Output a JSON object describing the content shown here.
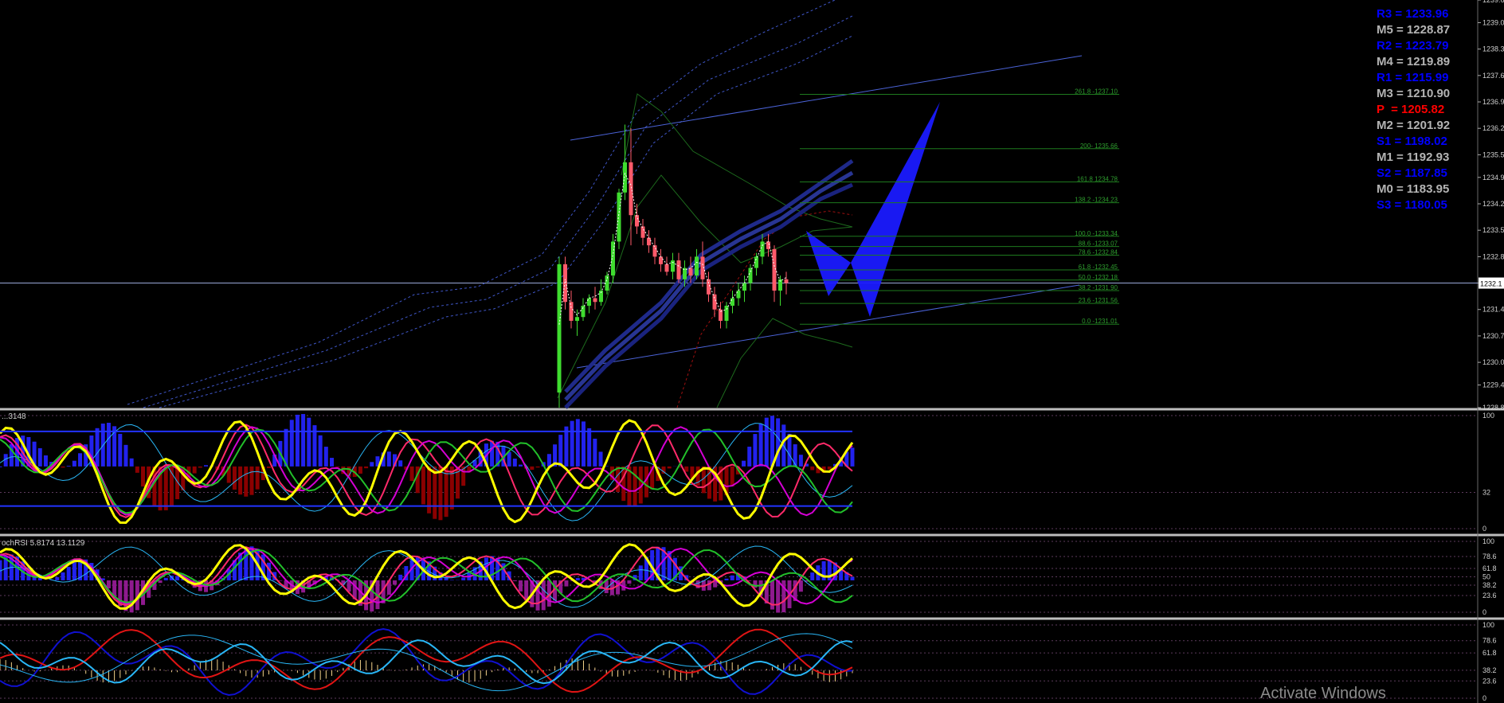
{
  "chart_data": {
    "type": "line",
    "main": {
      "ylim": [
        1228.8,
        1239.6
      ],
      "price_ticks": [
        1239.6,
        1239.0,
        1238.3,
        1237.6,
        1236.9,
        1236.2,
        1235.5,
        1234.9,
        1234.2,
        1233.5,
        1232.8,
        1232.1,
        1231.4,
        1230.7,
        1230.0,
        1229.4,
        1228.8
      ],
      "current_price_label": "1232.1",
      "current_price": 1232.1,
      "candles": [
        [
          1229.2,
          1232.8,
          1228.8,
          1232.6
        ],
        [
          1232.6,
          1232.8,
          1231.4,
          1231.6
        ],
        [
          1231.6,
          1231.9,
          1230.9,
          1231.1
        ],
        [
          1231.1,
          1231.4,
          1230.7,
          1231.2
        ],
        [
          1231.2,
          1231.7,
          1231.1,
          1231.5
        ],
        [
          1231.5,
          1231.8,
          1231.3,
          1231.7
        ],
        [
          1231.7,
          1232.0,
          1231.4,
          1231.6
        ],
        [
          1231.6,
          1232.2,
          1231.5,
          1231.9
        ],
        [
          1231.9,
          1232.4,
          1231.8,
          1232.3
        ],
        [
          1232.3,
          1233.4,
          1232.1,
          1233.2
        ],
        [
          1233.2,
          1234.6,
          1233.0,
          1234.5
        ],
        [
          1234.5,
          1236.3,
          1234.3,
          1235.3
        ],
        [
          1235.3,
          1236.2,
          1233.1,
          1233.9
        ],
        [
          1233.9,
          1234.2,
          1233.4,
          1233.6
        ],
        [
          1233.6,
          1233.8,
          1233.1,
          1233.3
        ],
        [
          1233.3,
          1233.5,
          1232.9,
          1233.1
        ],
        [
          1233.1,
          1233.3,
          1232.6,
          1232.8
        ],
        [
          1232.8,
          1233.0,
          1232.4,
          1232.6
        ],
        [
          1232.6,
          1232.8,
          1232.3,
          1232.4
        ],
        [
          1232.4,
          1232.9,
          1232.2,
          1232.7
        ],
        [
          1232.7,
          1232.9,
          1232.1,
          1232.2
        ],
        [
          1232.2,
          1232.7,
          1232.0,
          1232.5
        ],
        [
          1232.5,
          1232.8,
          1232.1,
          1232.3
        ],
        [
          1232.3,
          1233.0,
          1232.2,
          1232.8
        ],
        [
          1232.8,
          1233.2,
          1232.0,
          1232.2
        ],
        [
          1232.2,
          1232.4,
          1231.6,
          1231.8
        ],
        [
          1231.8,
          1232.0,
          1231.2,
          1231.4
        ],
        [
          1231.4,
          1231.6,
          1230.9,
          1231.1
        ],
        [
          1231.1,
          1231.6,
          1230.9,
          1231.5
        ],
        [
          1231.5,
          1231.9,
          1231.3,
          1231.7
        ],
        [
          1231.7,
          1232.1,
          1231.5,
          1231.9
        ],
        [
          1231.9,
          1232.3,
          1231.6,
          1232.1
        ],
        [
          1232.1,
          1232.6,
          1231.9,
          1232.5
        ],
        [
          1232.5,
          1232.9,
          1232.3,
          1232.8
        ],
        [
          1232.8,
          1233.4,
          1232.6,
          1233.2
        ],
        [
          1233.2,
          1233.4,
          1232.8,
          1233.0
        ],
        [
          1233.0,
          1233.1,
          1231.6,
          1231.9
        ],
        [
          1231.9,
          1232.3,
          1231.5,
          1232.2
        ],
        [
          1232.2,
          1232.4,
          1231.8,
          1232.1
        ]
      ],
      "fib_levels": [
        {
          "label": "261.8 -1237.10",
          "price": 1237.1
        },
        {
          "label": "200- 1235.66",
          "price": 1235.66
        },
        {
          "label": "161.8 1234.78",
          "price": 1234.78
        },
        {
          "label": "138.2 -1234.23",
          "price": 1234.23
        },
        {
          "label": "100.0 -1233.34",
          "price": 1233.34
        },
        {
          "label": "88.6 -1233.07",
          "price": 1233.07
        },
        {
          "label": "78.6 -1232.84",
          "price": 1232.84
        },
        {
          "label": "61.8 -1232.45",
          "price": 1232.45
        },
        {
          "label": "50.0 -1232.18",
          "price": 1232.18
        },
        {
          "label": "38.2 -1231.90",
          "price": 1231.9
        },
        {
          "label": "23.6 -1231.56",
          "price": 1231.56
        },
        {
          "label": "0.0 -1231.01",
          "price": 1231.01
        }
      ]
    },
    "pivots": [
      {
        "text": "R3 = 1233.96",
        "color": "#0000ff"
      },
      {
        "text": "M5 = 1228.87",
        "color": "#b4b4b4"
      },
      {
        "text": "R2 = 1223.79",
        "color": "#0000ff"
      },
      {
        "text": "M4 = 1219.89",
        "color": "#b4b4b4"
      },
      {
        "text": "R1 = 1215.99",
        "color": "#0000ff"
      },
      {
        "text": "M3 = 1210.90",
        "color": "#b4b4b4"
      },
      {
        "text": "P  = 1205.82",
        "color": "#ff0000"
      },
      {
        "text": "M2 = 1201.92",
        "color": "#b4b4b4"
      },
      {
        "text": "S1 = 1198.02",
        "color": "#0000ff"
      },
      {
        "text": "M1 = 1192.93",
        "color": "#b4b4b4"
      },
      {
        "text": "S2 = 1187.85",
        "color": "#0000ff"
      },
      {
        "text": "M0 = 1183.95",
        "color": "#b4b4b4"
      },
      {
        "text": "S3 = 1180.05",
        "color": "#0000ff"
      }
    ],
    "indicators": [
      {
        "label": "...3148",
        "levels": [
          {
            "label": "100",
            "value": 100
          },
          {
            "label": "32",
            "value": 32
          },
          {
            "label": "0",
            "value": 0
          }
        ]
      },
      {
        "label": "ochRSI 5.8174 13.1129",
        "levels": [
          {
            "label": "100",
            "value": 100
          },
          {
            "label": "78.6",
            "value": 78.6
          },
          {
            "label": "61.8",
            "value": 61.8
          },
          {
            "label": "50",
            "value": 50
          },
          {
            "label": "38.2",
            "value": 38.2
          },
          {
            "label": "23.6",
            "value": 23.6
          },
          {
            "label": "0",
            "value": 0
          }
        ]
      },
      {
        "label": "",
        "levels": [
          {
            "label": "100",
            "value": 100
          },
          {
            "label": "78.6",
            "value": 78.6
          },
          {
            "label": "61.8",
            "value": 61.8
          },
          {
            "label": "38.2",
            "value": 38.2
          },
          {
            "label": "23.6",
            "value": 23.6
          },
          {
            "label": "0",
            "value": 0
          }
        ]
      }
    ]
  },
  "watermark": "Activate Windows",
  "colors": {
    "up": "#3fdc2f",
    "down": "#ff5a6a",
    "accent_blue": "#1e1eff",
    "pivot_blue": "#0000ff",
    "pivot_gray": "#b4b4b4",
    "pivot_red": "#ff0000"
  }
}
